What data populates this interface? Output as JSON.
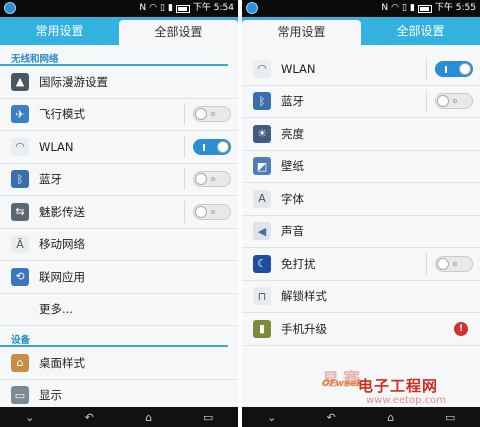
{
  "left": {
    "status": {
      "time": "下午 5:54"
    },
    "tabs": [
      "常用设置",
      "全部设置"
    ],
    "active_tab": 1,
    "sections": [
      {
        "header": "无线和网络",
        "items": [
          {
            "label": "国际漫游设置",
            "icon": "triangle-icon",
            "color": "#4a5866"
          },
          {
            "label": "飞行模式",
            "icon": "airplane-icon",
            "color": "#3c7fc4",
            "toggle": "off"
          },
          {
            "label": "WLAN",
            "icon": "wifi-icon",
            "color": "#e9eef2",
            "toggle": "on"
          },
          {
            "label": "蓝牙",
            "icon": "bluetooth-icon",
            "color": "#3a6fae",
            "toggle": "off"
          },
          {
            "label": "魅影传送",
            "icon": "transfer-icon",
            "color": "#5b6774",
            "toggle": "off"
          },
          {
            "label": "移动网络",
            "icon": "antenna-icon",
            "color": "#eaeef1"
          },
          {
            "label": "联网应用",
            "icon": "network-apps-icon",
            "color": "#3b76bd"
          },
          {
            "label": "更多...",
            "icon": "",
            "color": ""
          }
        ]
      },
      {
        "header": "设备",
        "items": [
          {
            "label": "桌面样式",
            "icon": "home-icon",
            "color": "#c98d4a"
          },
          {
            "label": "显示",
            "icon": "display-icon",
            "color": "#7d8a96"
          }
        ]
      }
    ]
  },
  "right": {
    "status": {
      "time": "下午 5:55"
    },
    "tabs": [
      "常用设置",
      "全部设置"
    ],
    "active_tab": 0,
    "items": [
      {
        "label": "WLAN",
        "icon": "wifi-icon",
        "color": "#e9eef2",
        "toggle": "on"
      },
      {
        "label": "蓝牙",
        "icon": "bluetooth-icon",
        "color": "#3a6fae",
        "toggle": "off"
      },
      {
        "label": "亮度",
        "icon": "brightness-icon",
        "color": "#3f5c82"
      },
      {
        "label": "壁纸",
        "icon": "wallpaper-icon",
        "color": "#4f7db8"
      },
      {
        "label": "字体",
        "icon": "font-icon",
        "color": "#e4e8ec"
      },
      {
        "label": "声音",
        "icon": "speaker-icon",
        "color": "#dfe4e8"
      },
      {
        "label": "免打扰",
        "icon": "moon-icon",
        "color": "#1e4f9e",
        "toggle": "off"
      },
      {
        "label": "解锁样式",
        "icon": "lock-icon",
        "color": "#e8ebee"
      },
      {
        "label": "手机升级",
        "icon": "phone-update-icon",
        "color": "#7c8a3a",
        "badge": "!"
      }
    ]
  },
  "watermark": {
    "top": "易赛",
    "brand": "OFweek",
    "main": "电子工程网",
    "url": "www.eetop.com"
  }
}
